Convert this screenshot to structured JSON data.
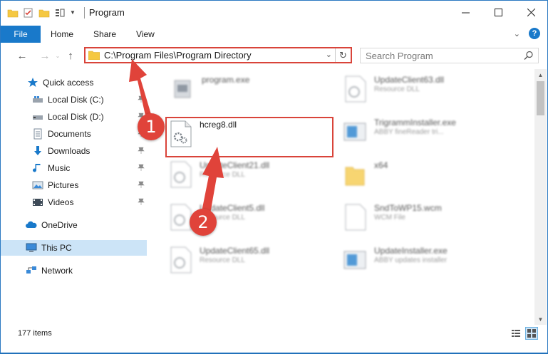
{
  "window": {
    "title": "Program",
    "controls": [
      "minimize",
      "maximize",
      "close"
    ]
  },
  "ribbon": {
    "tabs": [
      "File",
      "Home",
      "Share",
      "View"
    ],
    "help_label": "?"
  },
  "address_bar": {
    "path": "C:\\Program Files\\Program Directory"
  },
  "search": {
    "placeholder": "Search Program"
  },
  "sidebar": {
    "items": [
      {
        "label": "Quick access",
        "icon": "star-icon",
        "pinned": false
      },
      {
        "label": "Local Disk (C:)",
        "icon": "drive-icon",
        "pinned": true
      },
      {
        "label": "Local Disk (D:)",
        "icon": "drive-icon",
        "pinned": true
      },
      {
        "label": "Documents",
        "icon": "documents-icon",
        "pinned": true
      },
      {
        "label": "Downloads",
        "icon": "download-icon",
        "pinned": true
      },
      {
        "label": "Music",
        "icon": "music-icon",
        "pinned": true
      },
      {
        "label": "Pictures",
        "icon": "pictures-icon",
        "pinned": true
      },
      {
        "label": "Videos",
        "icon": "videos-icon",
        "pinned": true
      },
      {
        "label": "OneDrive",
        "icon": "cloud-icon",
        "pinned": false
      },
      {
        "label": "This PC",
        "icon": "computer-icon",
        "pinned": false,
        "selected": true
      },
      {
        "label": "Network",
        "icon": "network-icon",
        "pinned": false
      }
    ]
  },
  "files": [
    {
      "name": "program.exe",
      "type": "",
      "icon": "exe-icon"
    },
    {
      "name": "UpdateClient63.dll",
      "type": "Resource DLL",
      "icon": "dll-icon"
    },
    {
      "name": "hcreg8.dll",
      "type": "",
      "icon": "dll-icon",
      "highlighted": true
    },
    {
      "name": "TrigrammInstaller.exe",
      "type": "ABBY fineReader tri...",
      "icon": "installer-icon"
    },
    {
      "name": "UpdateClient21.dll",
      "type": "Resource DLL",
      "icon": "dll-icon"
    },
    {
      "name": "x64",
      "type": "",
      "icon": "folder-icon"
    },
    {
      "name": "UpdateClient5.dll",
      "type": "Resource DLL",
      "icon": "dll-icon"
    },
    {
      "name": "SndToWP15.wcm",
      "type": "WCM File",
      "icon": "file-icon"
    },
    {
      "name": "UpdateClient65.dll",
      "type": "Resource DLL",
      "icon": "dll-icon"
    },
    {
      "name": "UpdateInstaller.exe",
      "type": "ABBY updates installer",
      "icon": "installer-icon"
    }
  ],
  "status": {
    "item_count": "177 items"
  },
  "annotations": {
    "step1": "1",
    "step2": "2"
  },
  "colors": {
    "accent": "#1979ca",
    "annotation_red": "#e0433a",
    "selection": "#cce4f7"
  }
}
